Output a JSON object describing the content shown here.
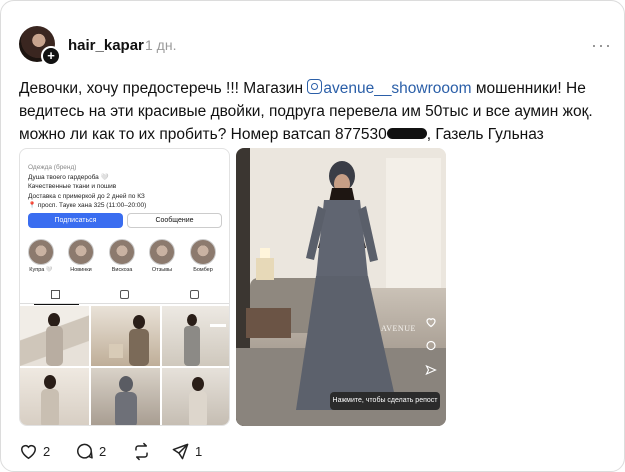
{
  "post": {
    "username": "hair_kapar",
    "time": "1 дн.",
    "more_icon": "more-horizontal-icon",
    "text_before": "Девочки, хочу предостеречь !!! Магазин ",
    "mention": "avenue__showrooom",
    "text_after": " мошенники! Не ведитесь на эти красивые двойки, подруга перевела им 50тыс и все аумин жоқ. можно ли как то их пробить? Номер ватсап 877530",
    "text_end": ", Газель Гульназ"
  },
  "image1": {
    "category": "Одежда (бренд)",
    "lines": [
      "Душа твоего гардероба 🤍",
      "Качественные ткани и пошив",
      "Доставка с примеркой до 2 дней по КЗ",
      "📍 просп. Тауке хана 325 (11:00–20:00)"
    ],
    "subscribe": "Подписаться",
    "message": "Сообщение",
    "highlights": [
      "Купра 🤍",
      "Новинки",
      "Вискоза",
      "Отзывы",
      "Бомбер"
    ]
  },
  "image2": {
    "brand": "AVENUE",
    "tip": "Нажмите, чтобы сделать репост"
  },
  "actions": {
    "likes": "2",
    "comments": "2",
    "shares": "1"
  },
  "colors": {
    "mention": "#2b5fa8",
    "button_blue": "#3a6df0"
  }
}
